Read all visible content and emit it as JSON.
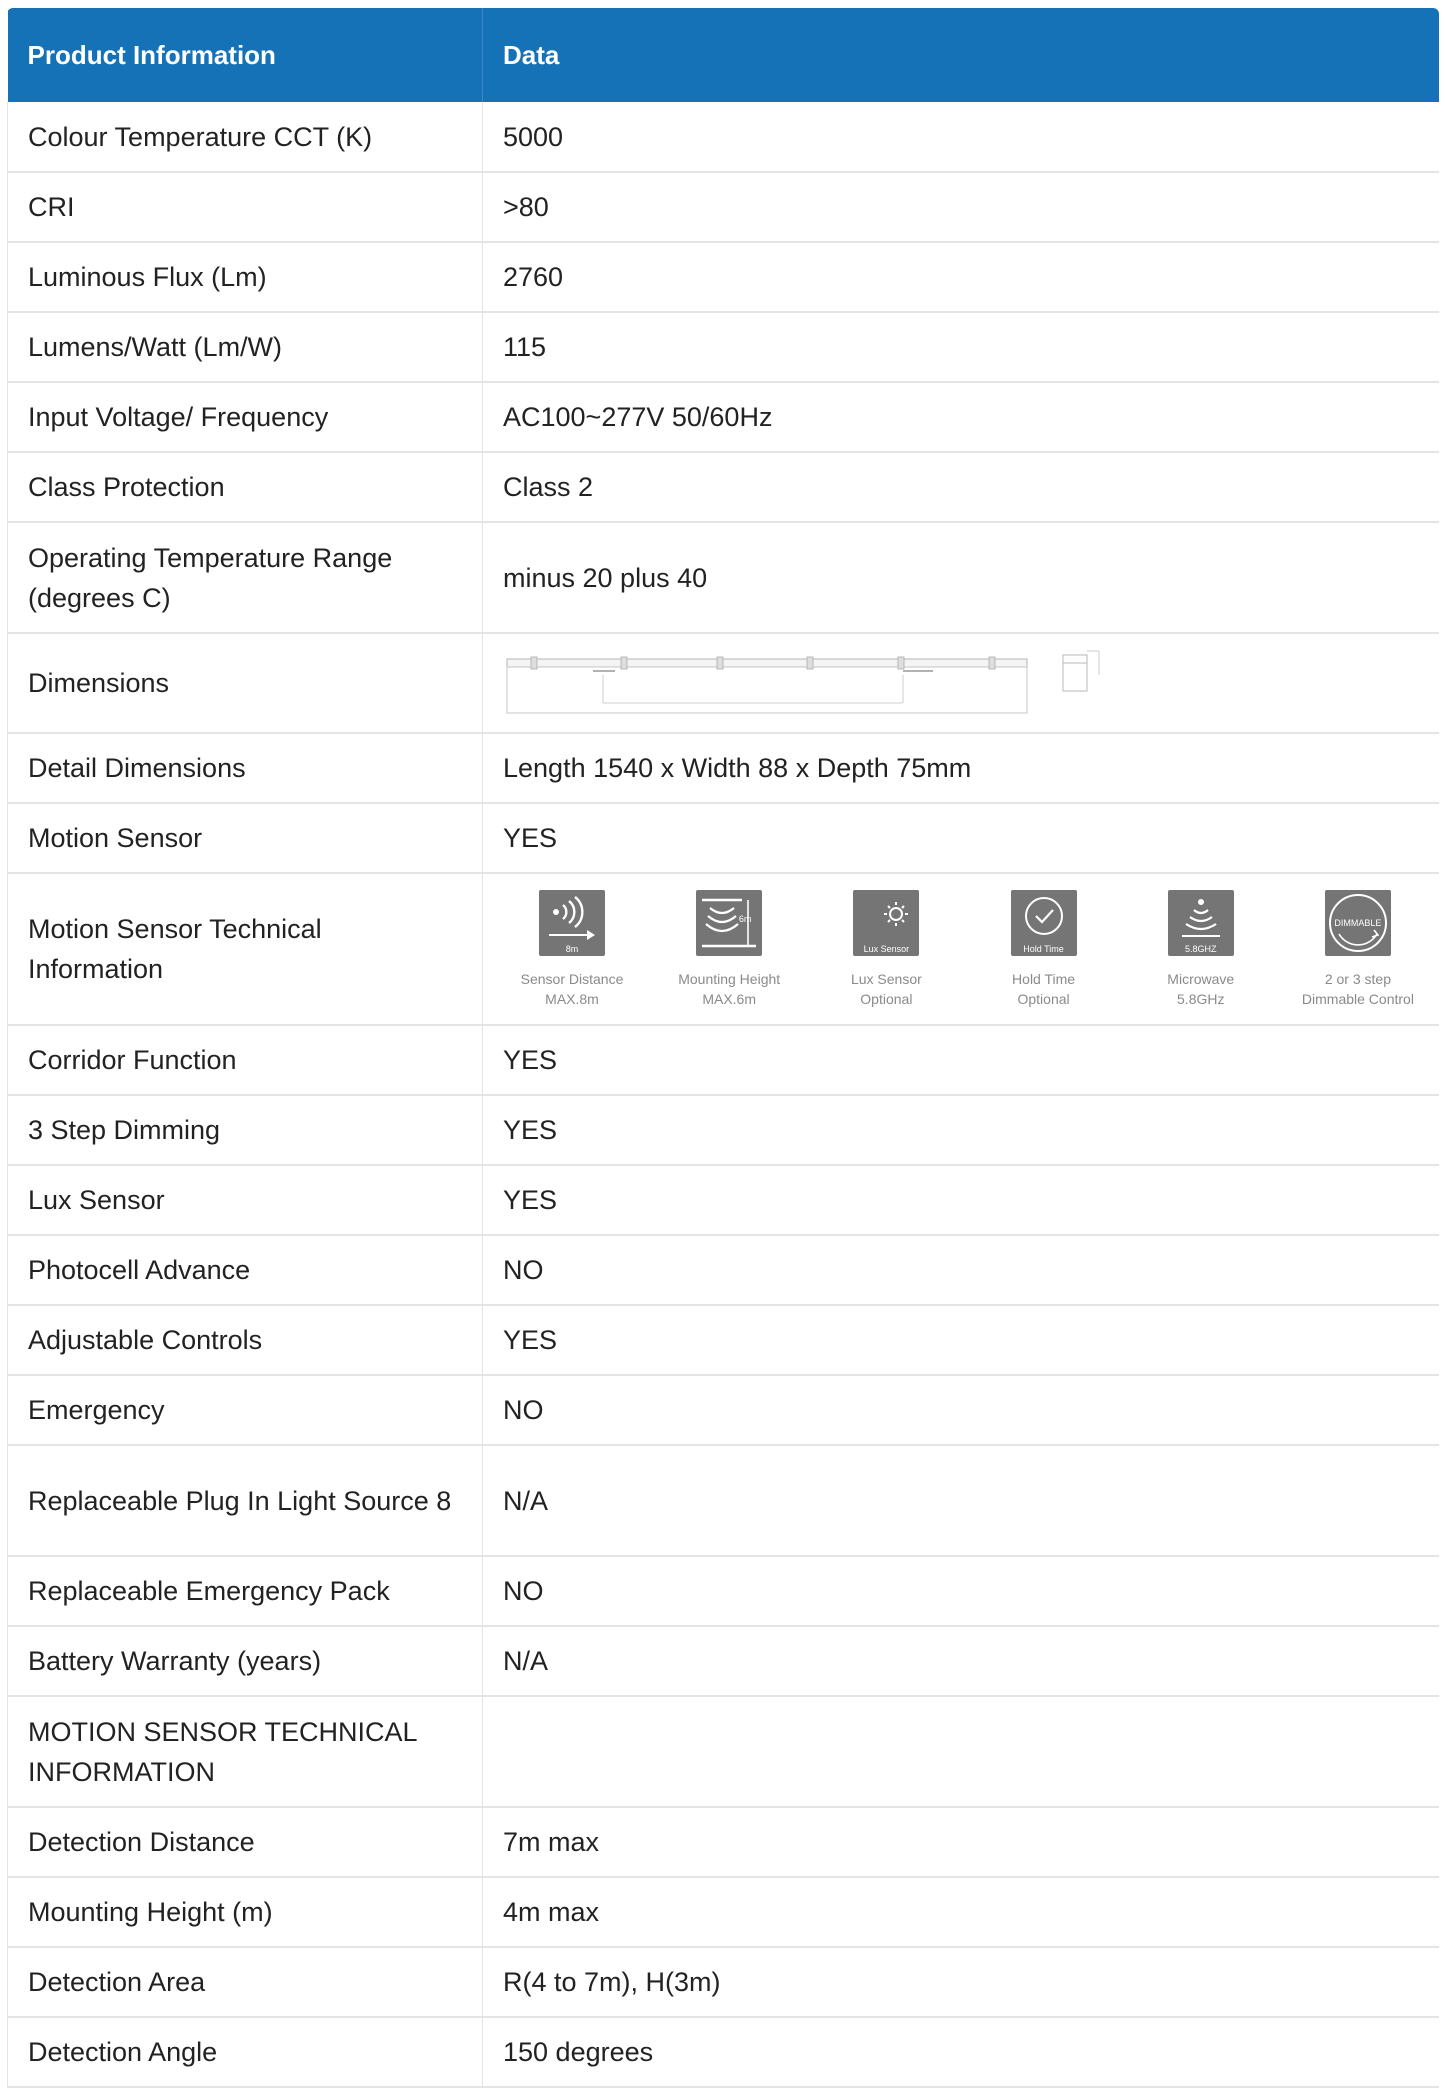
{
  "table": {
    "headers": {
      "col1": "Product Information",
      "col2": "Data"
    },
    "rows": [
      {
        "label": "Colour Temperature CCT (K)",
        "value": "5000"
      },
      {
        "label": "CRI",
        "value": ">80"
      },
      {
        "label": "Luminous Flux (Lm)",
        "value": "2760"
      },
      {
        "label": "Lumens/Watt (Lm/W)",
        "value": "115"
      },
      {
        "label": "Input Voltage/ Frequency",
        "value": "AC100~277V 50/60Hz"
      },
      {
        "label": "Class Protection",
        "value": "Class 2"
      },
      {
        "label": "Operating Temperature Range (degrees C)",
        "value": "minus 20 plus 40"
      },
      {
        "label": "Dimensions",
        "value": ""
      },
      {
        "label": "Detail Dimensions",
        "value": "Length 1540 x Width 88 x Depth 75mm"
      },
      {
        "label": "Motion Sensor",
        "value": "YES"
      },
      {
        "label": "Motion Sensor Technical Information",
        "value": ""
      },
      {
        "label": "Corridor Function",
        "value": "YES"
      },
      {
        "label": "3 Step Dimming",
        "value": "YES"
      },
      {
        "label": "Lux Sensor",
        "value": "YES"
      },
      {
        "label": "Photocell Advance",
        "value": "NO"
      },
      {
        "label": "Adjustable Controls",
        "value": "YES"
      },
      {
        "label": "Emergency",
        "value": "NO"
      },
      {
        "label": "Replaceable Plug In Light Source 8",
        "value": "N/A"
      },
      {
        "label": "Replaceable Emergency Pack",
        "value": "NO"
      },
      {
        "label": "Battery Warranty (years)",
        "value": "N/A"
      },
      {
        "label": "MOTION SENSOR TECHNICAL INFORMATION",
        "value": ""
      },
      {
        "label": "Detection Distance",
        "value": "7m max"
      },
      {
        "label": "Mounting Height (m)",
        "value": "4m max"
      },
      {
        "label": "Detection Area",
        "value": "R(4 to 7m), H(3m)"
      },
      {
        "label": "Detection Angle",
        "value": "150 degrees"
      }
    ]
  },
  "sensor_icons": [
    {
      "icon": "sensor-distance-icon",
      "tag": "8m",
      "caption_line1": "Sensor Distance",
      "caption_line2": "MAX.8m"
    },
    {
      "icon": "mounting-height-icon",
      "tag": "6m",
      "caption_line1": "Mounting Height",
      "caption_line2": "MAX.6m"
    },
    {
      "icon": "lux-sensor-icon",
      "tag": "Lux Sensor",
      "caption_line1": "Lux Sensor",
      "caption_line2": "Optional"
    },
    {
      "icon": "hold-time-icon",
      "tag": "Hold Time",
      "caption_line1": "Hold Time",
      "caption_line2": "Optional"
    },
    {
      "icon": "microwave-icon",
      "tag": "5.8GHZ",
      "caption_line1": "Microwave",
      "caption_line2": "5.8GHz"
    },
    {
      "icon": "dimmable-icon",
      "tag": "DIMMABLE",
      "caption_line1": "2 or 3 step",
      "caption_line2": "Dimmable Control"
    }
  ],
  "colors": {
    "header_bg": "#1672b6",
    "header_text": "#ffffff",
    "row_border": "#e4e4e4",
    "icon_bg": "#757575",
    "caption_text": "#8a8a8a"
  }
}
